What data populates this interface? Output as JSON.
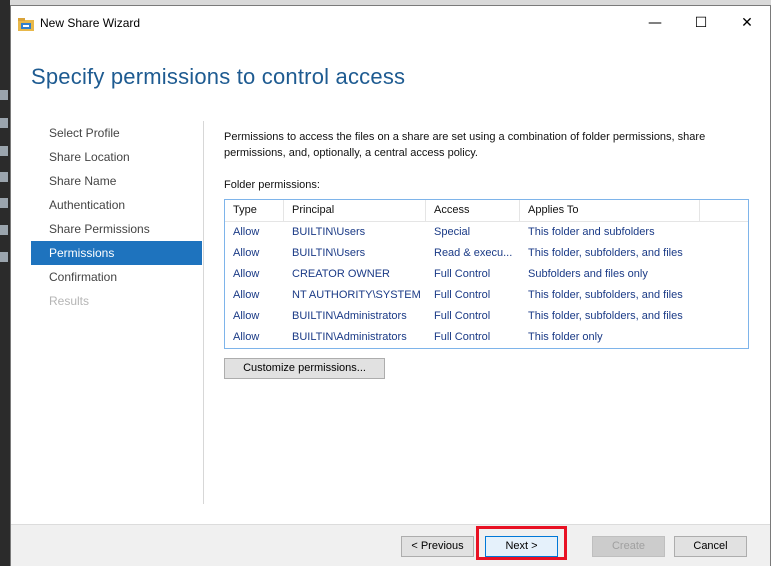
{
  "window": {
    "title": "New Share Wizard",
    "controls": {
      "minimize": "—",
      "maximize": "☐",
      "close": "✕"
    }
  },
  "page": {
    "heading": "Specify permissions to control access"
  },
  "nav": {
    "items": [
      {
        "label": "Select Profile",
        "state": "normal"
      },
      {
        "label": "Share Location",
        "state": "normal"
      },
      {
        "label": "Share Name",
        "state": "normal"
      },
      {
        "label": "Authentication",
        "state": "normal"
      },
      {
        "label": "Share Permissions",
        "state": "normal"
      },
      {
        "label": "Permissions",
        "state": "active"
      },
      {
        "label": "Confirmation",
        "state": "normal"
      },
      {
        "label": "Results",
        "state": "disabled"
      }
    ]
  },
  "content": {
    "description": "Permissions to access the files on a share are set using a combination of folder permissions, share permissions, and, optionally, a central access policy.",
    "folder_permissions_label": "Folder permissions:",
    "table": {
      "headers": [
        "Type",
        "Principal",
        "Access",
        "Applies To"
      ],
      "rows": [
        [
          "Allow",
          "BUILTIN\\Users",
          "Special",
          "This folder and subfolders"
        ],
        [
          "Allow",
          "BUILTIN\\Users",
          "Read & execu...",
          "This folder, subfolders, and files"
        ],
        [
          "Allow",
          "CREATOR OWNER",
          "Full Control",
          "Subfolders and files only"
        ],
        [
          "Allow",
          "NT AUTHORITY\\SYSTEM",
          "Full Control",
          "This folder, subfolders, and files"
        ],
        [
          "Allow",
          "BUILTIN\\Administrators",
          "Full Control",
          "This folder, subfolders, and files"
        ],
        [
          "Allow",
          "BUILTIN\\Administrators",
          "Full Control",
          "This folder only"
        ]
      ]
    },
    "customize_button": "Customize permissions..."
  },
  "footer": {
    "previous": "< Previous",
    "next": "Next >",
    "create": "Create",
    "cancel": "Cancel"
  },
  "colors": {
    "heading": "#1e5b91",
    "nav_active": "#1e73be",
    "highlight": "#e81123",
    "table_text": "#1a3a86"
  }
}
